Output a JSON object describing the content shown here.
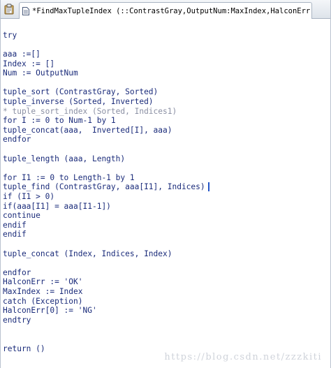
{
  "tab": {
    "title": "*FindMaxTupleIndex (::ContrastGray,OutputNum:MaxIndex,HalconErr)"
  },
  "editor": {
    "lines": [
      "try",
      "aaa :=[]",
      "Index := []",
      "Num := OutputNum",
      "tuple_sort (ContrastGray, Sorted)",
      "tuple_inverse (Sorted, Inverted)",
      "* tuple_sort_index (Sorted, Indices1)",
      "for I := 0 to Num-1 by 1",
      "tuple_concat(aaa,  Inverted[I], aaa)",
      "endfor",
      "tuple_length (aaa, Length)",
      "for I1 := 0 to Length-1 by 1",
      "tuple_find (ContrastGray, aaa[I1], Indices)",
      "if (I1 > 0)",
      "if(aaa[I1] = aaa[I1-1])",
      "continue",
      "endif",
      "endif",
      "tuple_concat (Index, Indices, Index)",
      "endfor",
      "HalconErr := 'OK'",
      "MaxIndex := Index",
      "catch (Exception)",
      "HalconErr[0] := 'NG'",
      "endtry",
      "return ()"
    ]
  },
  "watermark": "https://blog.csdn.net/zzzkiti"
}
